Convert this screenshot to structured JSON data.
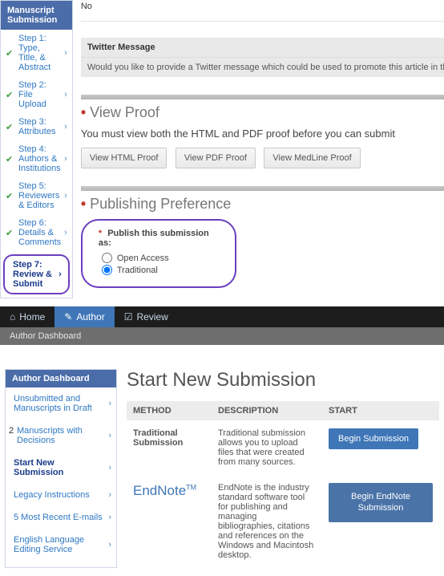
{
  "sidebar": {
    "title": "Manuscript Submission",
    "steps": [
      {
        "label": "Step 1: Type, Title, & Abstract"
      },
      {
        "label": "Step 2: File Upload"
      },
      {
        "label": "Step 3: Attributes"
      },
      {
        "label": "Step 4: Authors & Institutions"
      },
      {
        "label": "Step 5: Reviewers & Editors"
      },
      {
        "label": "Step 6: Details & Comments"
      }
    ],
    "current": "Step 7: Review & Submit"
  },
  "form": {
    "field_value": "No",
    "twitter_title": "Twitter Message",
    "twitter_body": "Would you like to provide a Twitter message which could be used to promote this article in the event i"
  },
  "proof": {
    "section": "View Proof",
    "note": "You must view both the HTML and PDF proof before you can submit",
    "btn_html": "View HTML Proof",
    "btn_pdf": "View PDF Proof",
    "btn_medline": "View MedLine Proof"
  },
  "pubpref": {
    "section": "Publishing Preference",
    "title": "Publish this submission as:",
    "opt_oa": "Open Access",
    "opt_trad": "Traditional"
  },
  "navbar": {
    "home": "Home",
    "author": "Author",
    "review": "Review",
    "sub": "Author Dashboard"
  },
  "dashboard": {
    "title": "Author Dashboard",
    "items": {
      "unsubmitted": "Unsubmitted and Manuscripts in Draft",
      "decisions_count": "2",
      "decisions": "Manuscripts with Decisions",
      "start_new": "Start New Submission",
      "legacy": "Legacy Instructions",
      "recent": "5 Most Recent E-mails",
      "editing": "English Language Editing Service"
    }
  },
  "main": {
    "heading": "Start New Submission",
    "headers": {
      "method": "METHOD",
      "description": "DESCRIPTION",
      "start": "START"
    },
    "rows": [
      {
        "method": "Traditional Submission",
        "desc": "Traditional submission allows you to upload files that were created from many sources.",
        "btn": "Begin Submission"
      },
      {
        "method_html": "EndNote",
        "method_tm": "TM",
        "desc": "EndNote is the industry standard software tool for publishing and managing bibliographies, citations and references on the Windows and Macintosh desktop.",
        "btn": "Begin EndNote Submission"
      }
    ]
  }
}
